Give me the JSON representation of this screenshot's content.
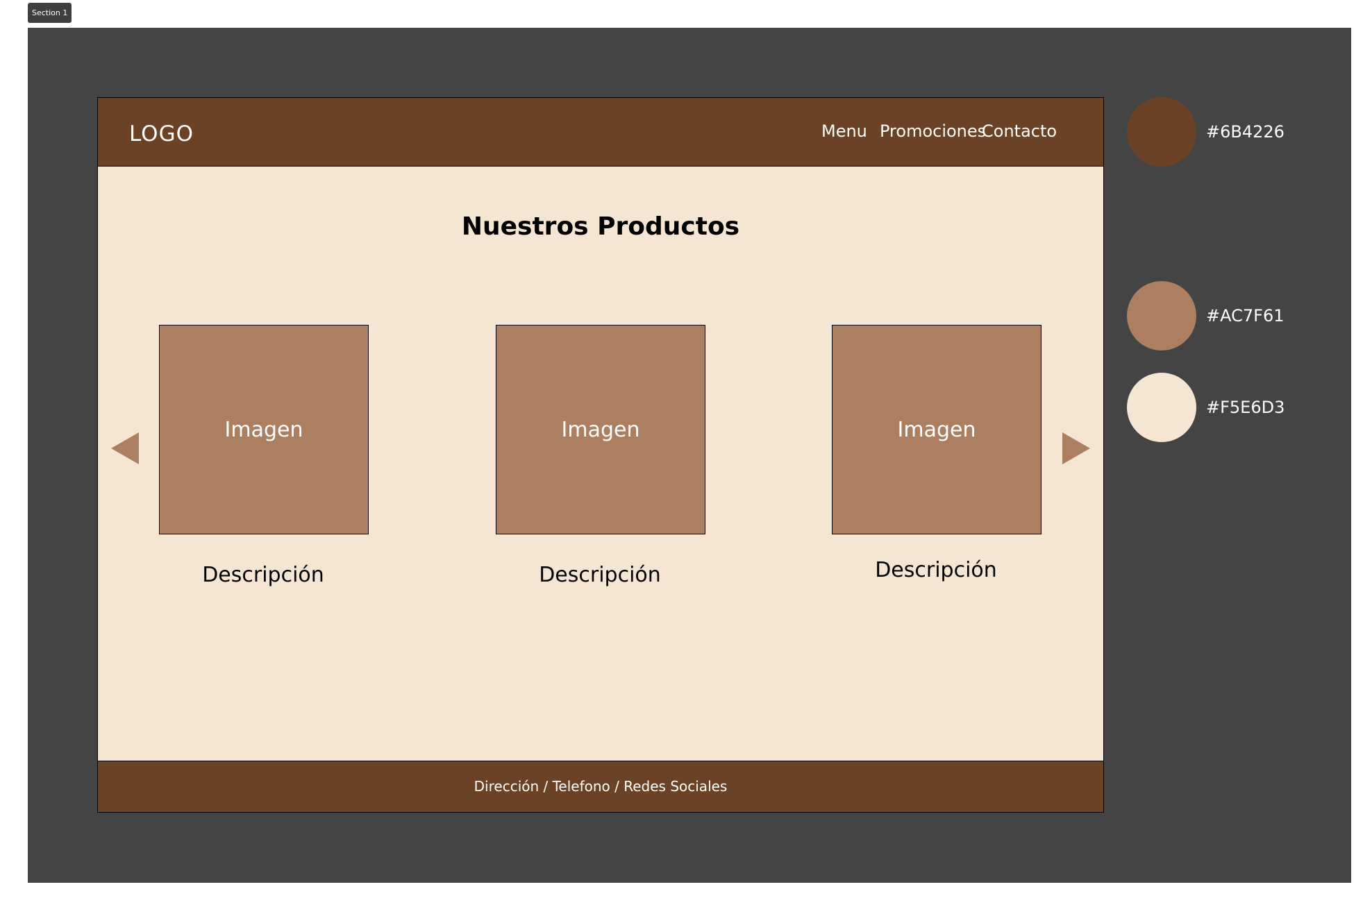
{
  "canvas": {
    "section_label": "Section 1"
  },
  "header": {
    "logo": "LOGO",
    "nav": [
      "Menu",
      "Promociones",
      "Contacto"
    ]
  },
  "main": {
    "title": "Nuestros Productos",
    "products": [
      {
        "image_label": "Imagen",
        "description": "Descripción"
      },
      {
        "image_label": "Imagen",
        "description": "Descripción"
      },
      {
        "image_label": "Imagen",
        "description": "Descripción"
      }
    ],
    "prev_icon": "triangle-left-icon",
    "next_icon": "triangle-right-icon"
  },
  "footer": {
    "text": "Dirección / Telefono / Redes Sociales"
  },
  "palette": [
    {
      "hex": "#6B4226",
      "label": "#6B4226"
    },
    {
      "hex": "#AC7F61",
      "label": "#AC7F61"
    },
    {
      "hex": "#F5E6D3",
      "label": "#F5E6D3"
    }
  ]
}
